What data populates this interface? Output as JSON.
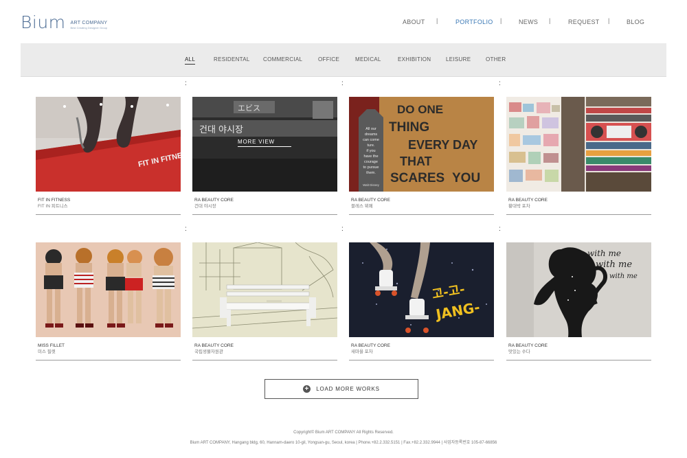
{
  "brand": {
    "logo": "Bium",
    "company": "ART COMPANY",
    "tagline": "Best Creating Designer Group"
  },
  "nav": [
    "ABOUT",
    "PORTFOLIO",
    "NEWS",
    "REQUEST",
    "BLOG"
  ],
  "nav_active": "PORTFOLIO",
  "filters": [
    "ALL",
    "RESIDENTAL",
    "COMMERCIAL",
    "OFFICE",
    "MEDICAL",
    "EXHIBITION",
    "LEISURE",
    "OTHER"
  ],
  "filter_active": "ALL",
  "hover_label": "MORE VIEW",
  "works": [
    {
      "category": "FIT IN FITNESS",
      "title": "FIT IN 피트니스"
    },
    {
      "category": "RA BEAUTY CORE",
      "title": "건대 야시장"
    },
    {
      "category": "RA BEAUTY CORE",
      "title": "블레스 뷔페"
    },
    {
      "category": "RA BEAUTY CORE",
      "title": "황대박 포차"
    },
    {
      "category": "MISS FILLET",
      "title": "미스 필렛"
    },
    {
      "category": "RA BEAUTY CORE",
      "title": "국립생물자원관"
    },
    {
      "category": "RA BEAUTY CORE",
      "title": "새마을 포차"
    },
    {
      "category": "RA BEAUTY CORE",
      "title": "맛있는 수다"
    }
  ],
  "thumb_text": {
    "fitness": "FIT IN FITNESS",
    "market_sign": "건대 야시장",
    "sign_a": "エビス",
    "quote_side": "All our dreams can come ture. if you have the courage to pursue them.",
    "quote_author": "Walt Disney",
    "quote_main": [
      "DO ONE",
      "THING",
      "EVERY DAY",
      "THAT",
      "SCARES",
      "YOU"
    ],
    "skate": "고-고-",
    "skate2": "JANG-",
    "script": "with me"
  },
  "load_more": "LOAD MORE WORKS",
  "footer": {
    "copyright": "Copyright© Bium ART COMPANY All Rights Reserved.",
    "address": "Bium ART COMPANY, Hangang bldg, 60, Hannam-daero 10-gil, Yongsan-gu, Seoul, korea  |  Phone.+82.2.332.5151  |  Fax.+82.2.332.9944  |  사업자등록번호 105-87-66856"
  }
}
